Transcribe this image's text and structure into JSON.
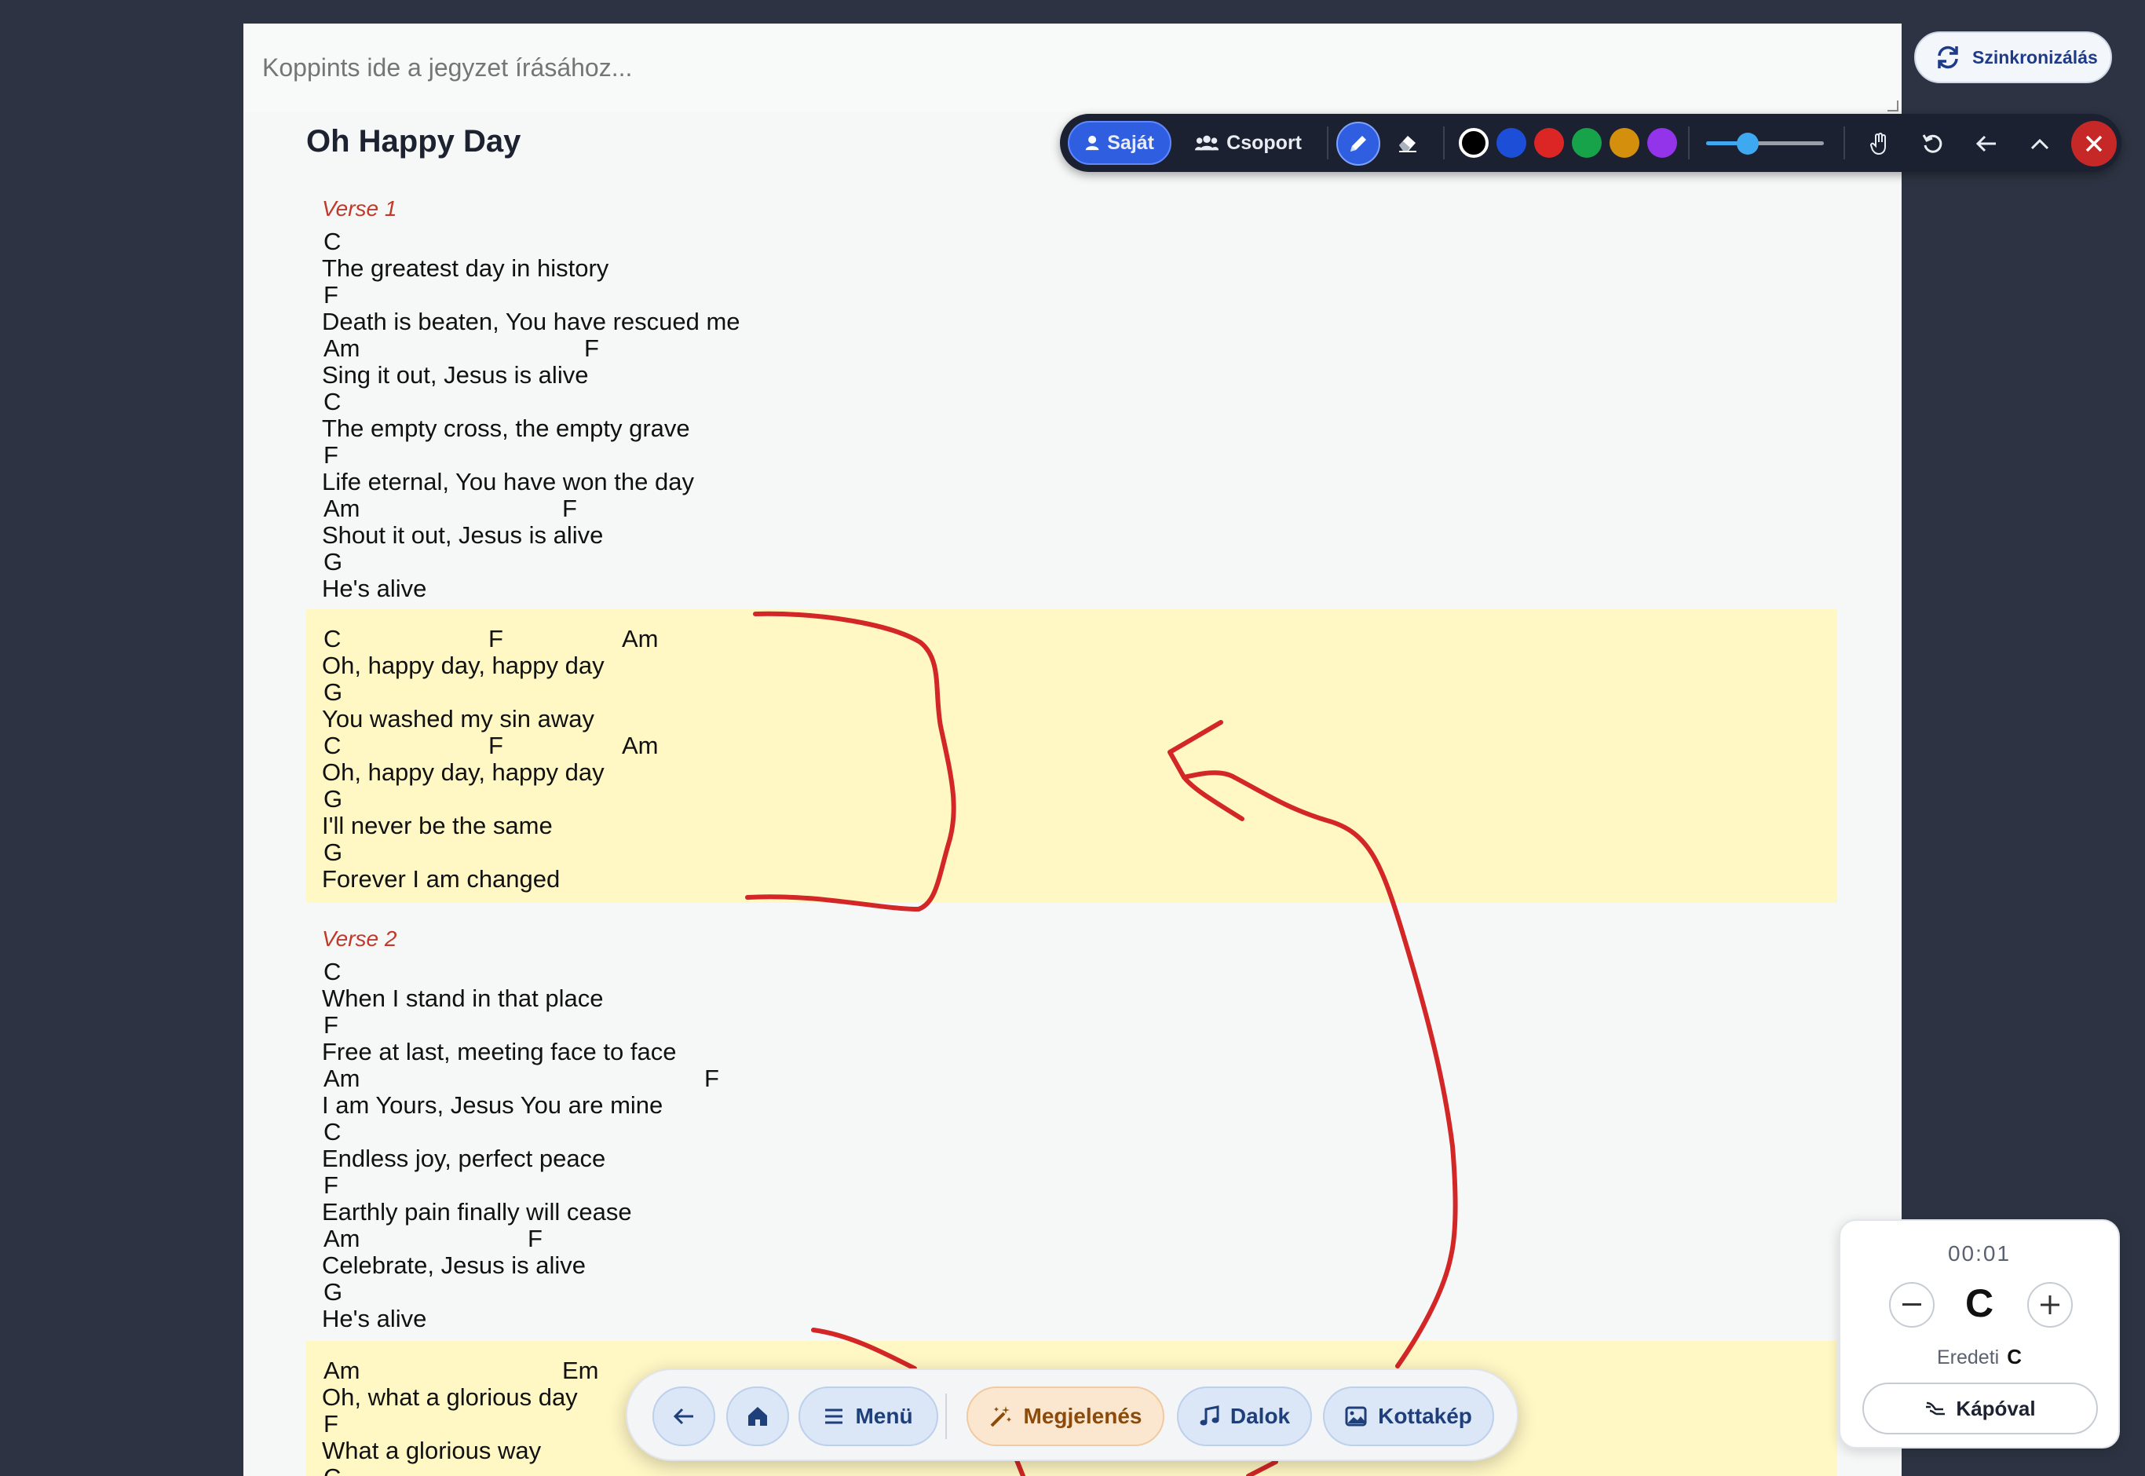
{
  "note": {
    "placeholder": "Koppints ide a jegyzet írásához..."
  },
  "song": {
    "title": "Oh Happy Day",
    "sections": [
      {
        "type": "verse",
        "label": "Verse 1",
        "lines": [
          {
            "chords": [
              {
                "c": "C",
                "o": 0
              }
            ],
            "lyric": "The greatest day in history"
          },
          {
            "chords": [
              {
                "c": "F",
                "o": 0
              }
            ],
            "lyric": "Death is beaten, You have rescued me"
          },
          {
            "chords": [
              {
                "c": "Am",
                "o": 0
              },
              {
                "c": "F",
                "o": 332
              }
            ],
            "lyric": "Sing it out, Jesus is alive"
          },
          {
            "chords": [
              {
                "c": "C",
                "o": 0
              }
            ],
            "lyric": "The empty cross, the empty grave"
          },
          {
            "chords": [
              {
                "c": "F",
                "o": 0
              }
            ],
            "lyric": "Life eternal, You have won the day"
          },
          {
            "chords": [
              {
                "c": "Am",
                "o": 0
              },
              {
                "c": "F",
                "o": 304
              }
            ],
            "lyric": "Shout it out, Jesus is alive"
          },
          {
            "chords": [
              {
                "c": "G",
                "o": 0
              }
            ],
            "lyric": "He's alive"
          }
        ]
      },
      {
        "type": "chorus",
        "label": "",
        "lines": [
          {
            "chords": [
              {
                "c": "C",
                "o": 0
              },
              {
                "c": "F",
                "o": 210
              },
              {
                "c": "Am",
                "o": 380
              }
            ],
            "lyric": "Oh, happy day,  happy day"
          },
          {
            "chords": [
              {
                "c": "G",
                "o": 0
              }
            ],
            "lyric": "You washed my sin away"
          },
          {
            "chords": [
              {
                "c": "C",
                "o": 0
              },
              {
                "c": "F",
                "o": 210
              },
              {
                "c": "Am",
                "o": 380
              }
            ],
            "lyric": "Oh, happy day,  happy day"
          },
          {
            "chords": [
              {
                "c": "G",
                "o": 0
              }
            ],
            "lyric": "I'll never be the same"
          },
          {
            "chords": [
              {
                "c": "G",
                "o": 0
              }
            ],
            "lyric": "Forever I am changed"
          }
        ]
      },
      {
        "type": "verse",
        "label": "Verse 2",
        "lines": [
          {
            "chords": [
              {
                "c": "C",
                "o": 0
              }
            ],
            "lyric": "When I stand in that place"
          },
          {
            "chords": [
              {
                "c": "F",
                "o": 0
              }
            ],
            "lyric": "Free at last, meeting face to face"
          },
          {
            "chords": [
              {
                "c": "Am",
                "o": 0
              },
              {
                "c": "F",
                "o": 485
              }
            ],
            "lyric": "I    am Yours, Jesus You are mine"
          },
          {
            "chords": [
              {
                "c": "C",
                "o": 0
              }
            ],
            "lyric": "Endless joy, perfect peace"
          },
          {
            "chords": [
              {
                "c": "F",
                "o": 0
              }
            ],
            "lyric": "Earthly pain finally will cease"
          },
          {
            "chords": [
              {
                "c": "Am",
                "o": 0
              },
              {
                "c": "F",
                "o": 260
              }
            ],
            "lyric": "Celebrate, Jesus is alive"
          },
          {
            "chords": [
              {
                "c": "G",
                "o": 0
              }
            ],
            "lyric": "He's alive"
          }
        ]
      },
      {
        "type": "chorus",
        "label": "",
        "lines": [
          {
            "chords": [
              {
                "c": "Am",
                "o": 0
              },
              {
                "c": "Em",
                "o": 304
              }
            ],
            "lyric": "Oh, what a glorious day"
          },
          {
            "chords": [
              {
                "c": "F",
                "o": 0
              }
            ],
            "lyric": "What a glorious way"
          },
          {
            "chords": [
              {
                "c": "C",
                "o": 0
              }
            ],
            "lyric": ""
          }
        ]
      }
    ]
  },
  "toolbar": {
    "own_label": "Saját",
    "group_label": "Csoport",
    "colors": [
      "#000000",
      "#1d4ed8",
      "#dc2626",
      "#16a34a",
      "#d4900d",
      "#9333ea"
    ],
    "selected_color": "#000000",
    "stroke_width": 0.35,
    "ink_color": "#d32626"
  },
  "sync": {
    "label": "Szinkronizálás"
  },
  "bottom_nav": {
    "menu_label": "Menü",
    "appearance_label": "Megjelenés",
    "songs_label": "Dalok",
    "sheet_label": "Kottakép"
  },
  "key_panel": {
    "timer": "00:01",
    "key": "C",
    "original_label": "Eredeti",
    "original_key": "C",
    "capo_label": "Kápóval"
  }
}
